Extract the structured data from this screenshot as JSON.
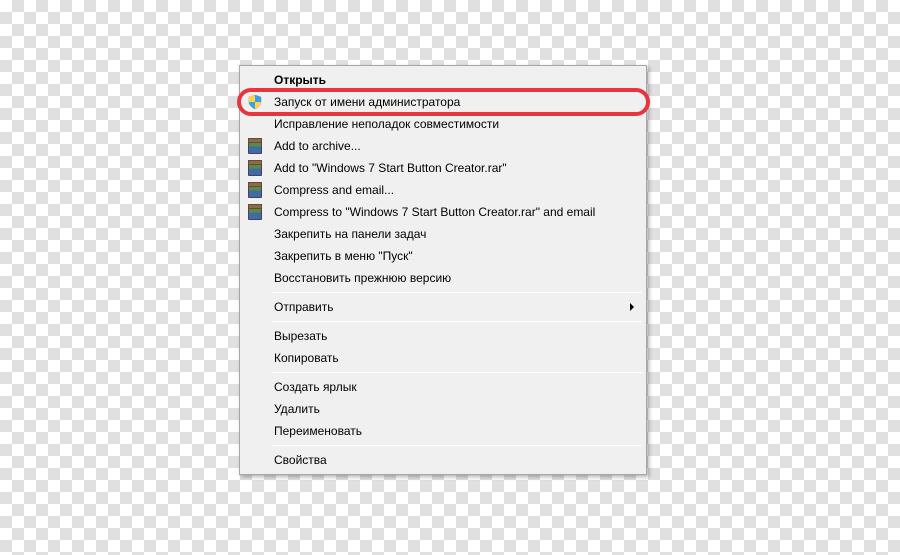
{
  "menu": {
    "groups": [
      [
        {
          "label": "Открыть",
          "bold": true,
          "icon": null,
          "submenu": false
        },
        {
          "label": "Запуск от имени администратора",
          "bold": false,
          "icon": "shield",
          "submenu": false
        },
        {
          "label": "Исправление неполадок совместимости",
          "bold": false,
          "icon": null,
          "submenu": false
        },
        {
          "label": "Add to archive...",
          "bold": false,
          "icon": "rar",
          "submenu": false
        },
        {
          "label": "Add to \"Windows 7 Start Button Creator.rar\"",
          "bold": false,
          "icon": "rar",
          "submenu": false
        },
        {
          "label": "Compress and email...",
          "bold": false,
          "icon": "rar",
          "submenu": false
        },
        {
          "label": "Compress to \"Windows 7 Start Button Creator.rar\" and email",
          "bold": false,
          "icon": "rar",
          "submenu": false
        },
        {
          "label": "Закрепить на панели задач",
          "bold": false,
          "icon": null,
          "submenu": false
        },
        {
          "label": "Закрепить в меню \"Пуск\"",
          "bold": false,
          "icon": null,
          "submenu": false
        },
        {
          "label": "Восстановить прежнюю версию",
          "bold": false,
          "icon": null,
          "submenu": false
        }
      ],
      [
        {
          "label": "Отправить",
          "bold": false,
          "icon": null,
          "submenu": true
        }
      ],
      [
        {
          "label": "Вырезать",
          "bold": false,
          "icon": null,
          "submenu": false
        },
        {
          "label": "Копировать",
          "bold": false,
          "icon": null,
          "submenu": false
        }
      ],
      [
        {
          "label": "Создать ярлык",
          "bold": false,
          "icon": null,
          "submenu": false
        },
        {
          "label": "Удалить",
          "bold": false,
          "icon": null,
          "submenu": false
        },
        {
          "label": "Переименовать",
          "bold": false,
          "icon": null,
          "submenu": false
        }
      ],
      [
        {
          "label": "Свойства",
          "bold": false,
          "icon": null,
          "submenu": false
        }
      ]
    ]
  },
  "highlight": {
    "target_label": "Запуск от имени администратора",
    "color": "#e6353f"
  }
}
